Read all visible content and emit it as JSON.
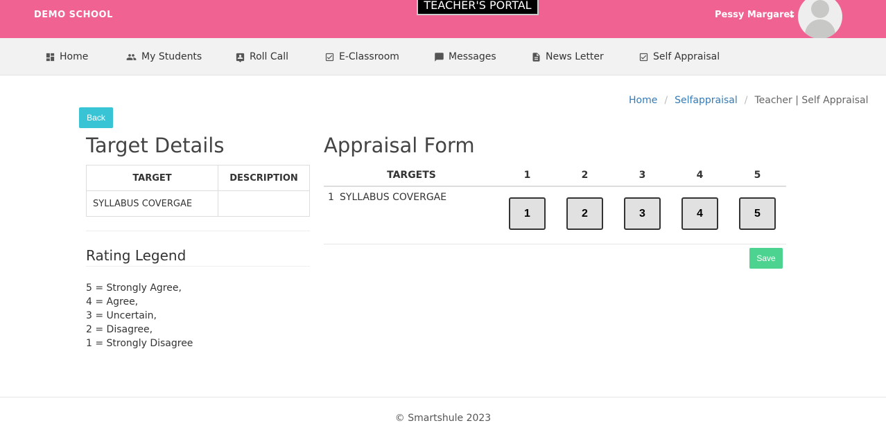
{
  "header": {
    "school_name": "DEMO SCHOOL",
    "portal_title": "TEACHER'S PORTAL",
    "user_name": "Pessy Margaret",
    "brand_color": "#f06292"
  },
  "nav": {
    "items": [
      {
        "label": "Home",
        "icon": "dashboard-icon"
      },
      {
        "label": "My Students",
        "icon": "people-icon"
      },
      {
        "label": "Roll Call",
        "icon": "contact-icon"
      },
      {
        "label": "E-Classroom",
        "icon": "checkbox-icon"
      },
      {
        "label": "Messages",
        "icon": "chat-icon"
      },
      {
        "label": "News Letter",
        "icon": "document-icon"
      },
      {
        "label": "Self Appraisal",
        "icon": "checkbox-icon"
      }
    ]
  },
  "breadcrumb": {
    "home": "Home",
    "section": "Selfappraisal",
    "current": "Teacher | Self Appraisal",
    "separator": "/"
  },
  "back_label": "Back",
  "target_details": {
    "title": "Target Details",
    "columns": [
      "TARGET",
      "DESCRIPTION"
    ],
    "rows": [
      {
        "target": "SYLLABUS COVERGAE",
        "description": ""
      }
    ]
  },
  "legend": {
    "title": "Rating Legend",
    "items": [
      "5 = Strongly Agree,",
      "4 = Agree,",
      "3 = Uncertain,",
      "2 = Disagree,",
      "1 = Strongly Disagree"
    ]
  },
  "appraisal_form": {
    "title": "Appraisal Form",
    "columns": [
      "TARGETS",
      "1",
      "2",
      "3",
      "4",
      "5"
    ],
    "rows": [
      {
        "num": "1",
        "target": "SYLLABUS COVERGAE",
        "ratings": [
          "1",
          "2",
          "3",
          "4",
          "5"
        ]
      }
    ],
    "save_label": "Save"
  },
  "footer": {
    "copyright": "© Smartshule 2023"
  }
}
